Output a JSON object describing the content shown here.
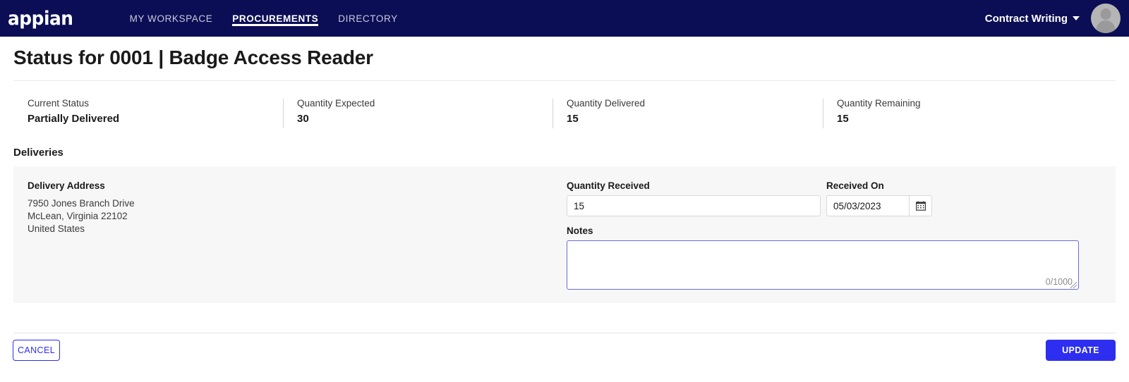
{
  "nav": {
    "logo_text": "appian",
    "links": [
      {
        "label": "MY WORKSPACE",
        "active": false
      },
      {
        "label": "PROCUREMENTS",
        "active": true
      },
      {
        "label": "DIRECTORY",
        "active": false
      }
    ],
    "user_menu_label": "Contract Writing"
  },
  "page": {
    "title": "Status for 0001 | Badge Access Reader"
  },
  "stats": [
    {
      "label": "Current Status",
      "value": "Partially Delivered"
    },
    {
      "label": "Quantity Expected",
      "value": "30"
    },
    {
      "label": "Quantity Delivered",
      "value": "15"
    },
    {
      "label": "Quantity Remaining",
      "value": "15"
    }
  ],
  "deliveries": {
    "heading": "Deliveries",
    "address_title": "Delivery Address",
    "address_lines": [
      "7950 Jones Branch Drive",
      "McLean, Virginia 22102",
      "United States"
    ],
    "quantity_received": {
      "label": "Quantity Received",
      "value": "15",
      "placeholder": ""
    },
    "received_on": {
      "label": "Received On",
      "value": "05/03/2023",
      "placeholder": "",
      "icon": "calendar-icon"
    },
    "notes": {
      "label": "Notes",
      "value": "",
      "placeholder": "",
      "counter": "0/1000"
    }
  },
  "footer": {
    "cancel_label": "CANCEL",
    "update_label": "UPDATE"
  },
  "colors": {
    "nav_background": "#0b0e55",
    "accent": "#2e2ef0",
    "focus_border": "#6a6ce0",
    "card_background": "#f7f7f7"
  }
}
